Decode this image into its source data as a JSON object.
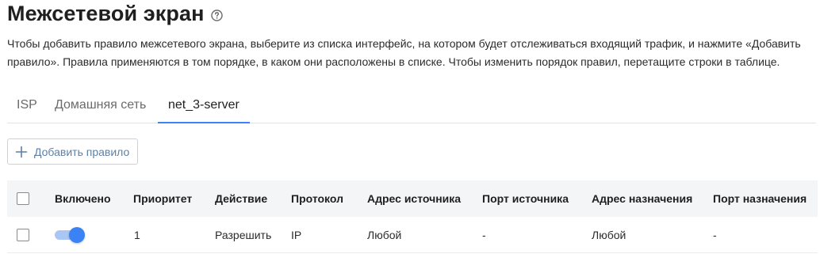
{
  "page": {
    "title": "Межсетевой экран",
    "description": "Чтобы добавить правило межсетевого экрана, выберите из списка интерфейс, на котором будет отслеживаться входящий трафик, и нажмите «Добавить правило». Правила применяются в том порядке, в каком они расположены в списке. Чтобы изменить порядок правил, перетащите строки в таблице."
  },
  "tabs": [
    {
      "label": "ISP",
      "active": false
    },
    {
      "label": "Домашняя сеть",
      "active": false
    },
    {
      "label": "net_3-server",
      "active": true
    }
  ],
  "toolbar": {
    "add_rule_label": "Добавить правило"
  },
  "table": {
    "columns": [
      "Включено",
      "Приоритет",
      "Действие",
      "Протокол",
      "Адрес источника",
      "Порт источника",
      "Адрес назначения",
      "Порт назначения"
    ],
    "rows": [
      {
        "enabled": true,
        "priority": "1",
        "action": "Разрешить",
        "protocol": "IP",
        "source_address": "Любой",
        "source_port": "-",
        "destination_address": "Любой",
        "destination_port": "-"
      }
    ]
  },
  "colors": {
    "accent": "#3b82f6",
    "toggle_track": "#a9c6f5",
    "button_text": "#5e7fa8",
    "header_bg": "#f4f5f7"
  },
  "icons": {
    "help": "help-circle-icon",
    "add": "plus-icon"
  }
}
